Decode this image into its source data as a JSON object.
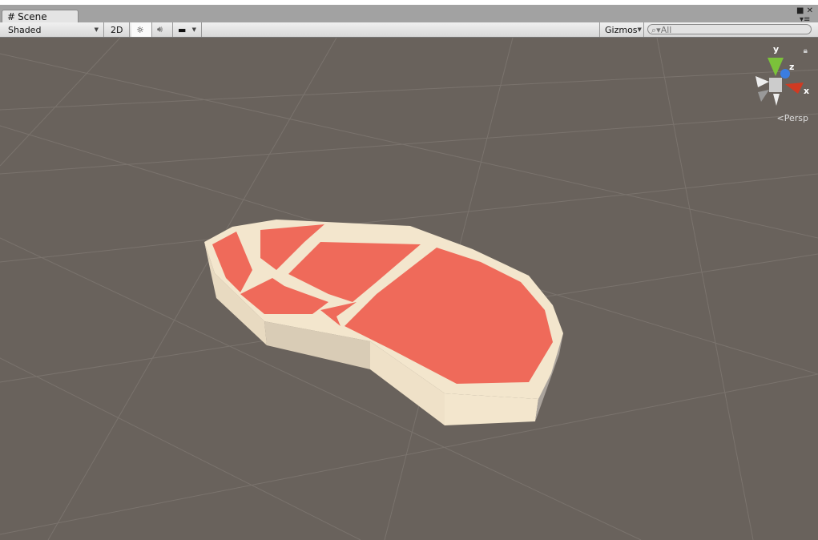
{
  "tab": {
    "title": "Scene",
    "icon": "grid-icon"
  },
  "toolbar": {
    "shading": "Shaded",
    "mode_2d": "2D",
    "gizmos": "Gizmos",
    "search_placeholder": "All"
  },
  "gizmo": {
    "y": "y",
    "z": "z",
    "x": "x",
    "projection": "Persp"
  },
  "colors": {
    "scene_bg": "#69625c",
    "object_red": "#ef6a5a",
    "object_cream": "#f3e6cd"
  }
}
